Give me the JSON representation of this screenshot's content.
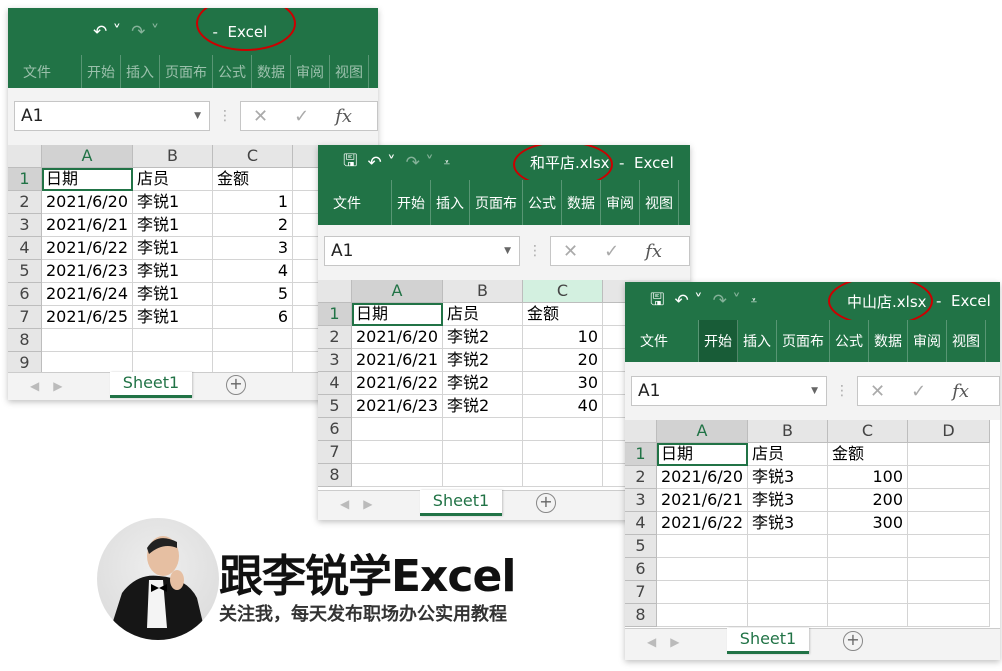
{
  "windows": [
    {
      "title": "",
      "app": "Excel",
      "ribbon_tabs": [
        "文件",
        "开始",
        "插入",
        "页面布",
        "公式",
        "数据",
        "审阅",
        "视图"
      ],
      "active_tab": -1,
      "name_box": "A1",
      "columns": [
        "A",
        "B",
        "C",
        ""
      ],
      "highlight_col": -1,
      "rows": [
        [
          "日期",
          "店员",
          "金额"
        ],
        [
          "2021/6/20",
          "李锐1",
          "1"
        ],
        [
          "2021/6/21",
          "李锐1",
          "2"
        ],
        [
          "2021/6/22",
          "李锐1",
          "3"
        ],
        [
          "2021/6/23",
          "李锐1",
          "4"
        ],
        [
          "2021/6/24",
          "李锐1",
          "5"
        ],
        [
          "2021/6/25",
          "李锐1",
          "6"
        ],
        [
          "",
          "",
          ""
        ],
        [
          "",
          "",
          ""
        ]
      ],
      "sheet_tab": "Sheet1"
    },
    {
      "title": "和平店.xlsx",
      "app": "Excel",
      "ribbon_tabs": [
        "文件",
        "开始",
        "插入",
        "页面布",
        "公式",
        "数据",
        "审阅",
        "视图"
      ],
      "active_tab": -1,
      "name_box": "A1",
      "columns": [
        "A",
        "B",
        "C",
        ""
      ],
      "highlight_col": 2,
      "rows": [
        [
          "日期",
          "店员",
          "金额"
        ],
        [
          "2021/6/20",
          "李锐2",
          "10"
        ],
        [
          "2021/6/21",
          "李锐2",
          "20"
        ],
        [
          "2021/6/22",
          "李锐2",
          "30"
        ],
        [
          "2021/6/23",
          "李锐2",
          "40"
        ],
        [
          "",
          "",
          ""
        ],
        [
          "",
          "",
          ""
        ],
        [
          "",
          "",
          ""
        ]
      ],
      "sheet_tab": "Sheet1"
    },
    {
      "title": "中山店.xlsx",
      "app": "Excel",
      "ribbon_tabs": [
        "文件",
        "开始",
        "插入",
        "页面布",
        "公式",
        "数据",
        "审阅",
        "视图"
      ],
      "active_tab": 1,
      "name_box": "A1",
      "columns": [
        "A",
        "B",
        "C",
        "D"
      ],
      "highlight_col": -1,
      "rows": [
        [
          "日期",
          "店员",
          "金额"
        ],
        [
          "2021/6/20",
          "李锐3",
          "100"
        ],
        [
          "2021/6/21",
          "李锐3",
          "200"
        ],
        [
          "2021/6/22",
          "李锐3",
          "300"
        ],
        [
          "",
          "",
          ""
        ],
        [
          "",
          "",
          ""
        ],
        [
          "",
          "",
          ""
        ],
        [
          "",
          "",
          ""
        ]
      ],
      "sheet_tab": "Sheet1"
    }
  ],
  "brand": {
    "title": "跟李锐学Excel",
    "subtitle": "关注我，每天发布职场办公实用教程"
  },
  "colors": {
    "excel_green": "#217346",
    "highlight_oval": "#cc0000"
  }
}
